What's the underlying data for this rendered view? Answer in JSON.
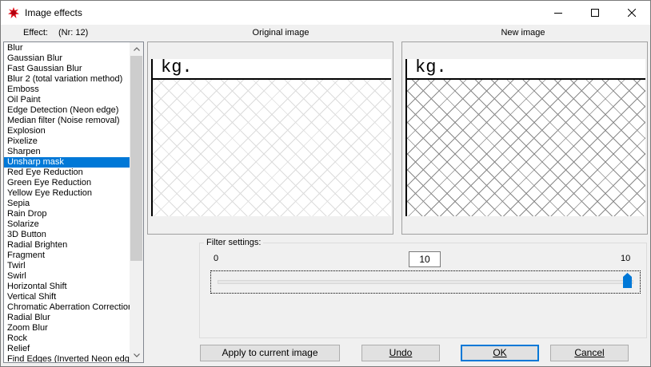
{
  "window": {
    "title": "Image effects"
  },
  "icons": {
    "app": "paint-splash-icon",
    "minimize": "minimize-icon",
    "maximize": "maximize-icon",
    "close": "close-icon"
  },
  "effect": {
    "label": "Effect:",
    "nr": "(Nr: 12)"
  },
  "effects_list": {
    "selected_index": 12,
    "items": [
      "Blur",
      "Gaussian Blur",
      "Fast Gaussian Blur",
      "Blur 2 (total variation method)",
      "Emboss",
      "Oil Paint",
      "Edge Detection (Neon edge)",
      "Median filter (Noise removal)",
      "Explosion",
      "Pixelize",
      "Sharpen",
      "Unsharp mask",
      "Red Eye Reduction",
      "Green Eye Reduction",
      "Yellow Eye Reduction",
      "Sepia",
      "Rain Drop",
      "Solarize",
      "3D Button",
      "Radial Brighten",
      "Fragment",
      "Twirl",
      "Swirl",
      "Horizontal Shift",
      "Vertical Shift",
      "Chromatic Aberration Correction",
      "Radial Blur",
      "Zoom Blur",
      "Rock",
      "Relief",
      "Find Edges (Inverted Neon edge)"
    ]
  },
  "preview": {
    "original_title": "Original image",
    "new_title": "New image",
    "image_text": "kg."
  },
  "filter_settings": {
    "label": "Filter settings:",
    "min": "0",
    "max": "10",
    "value": "10",
    "slider_fraction": 1.0
  },
  "buttons": {
    "apply": "Apply to current image",
    "undo": "Undo",
    "ok": "OK",
    "cancel": "Cancel"
  },
  "colors": {
    "selection": "#0078d7",
    "thumb": "#0078d7"
  }
}
